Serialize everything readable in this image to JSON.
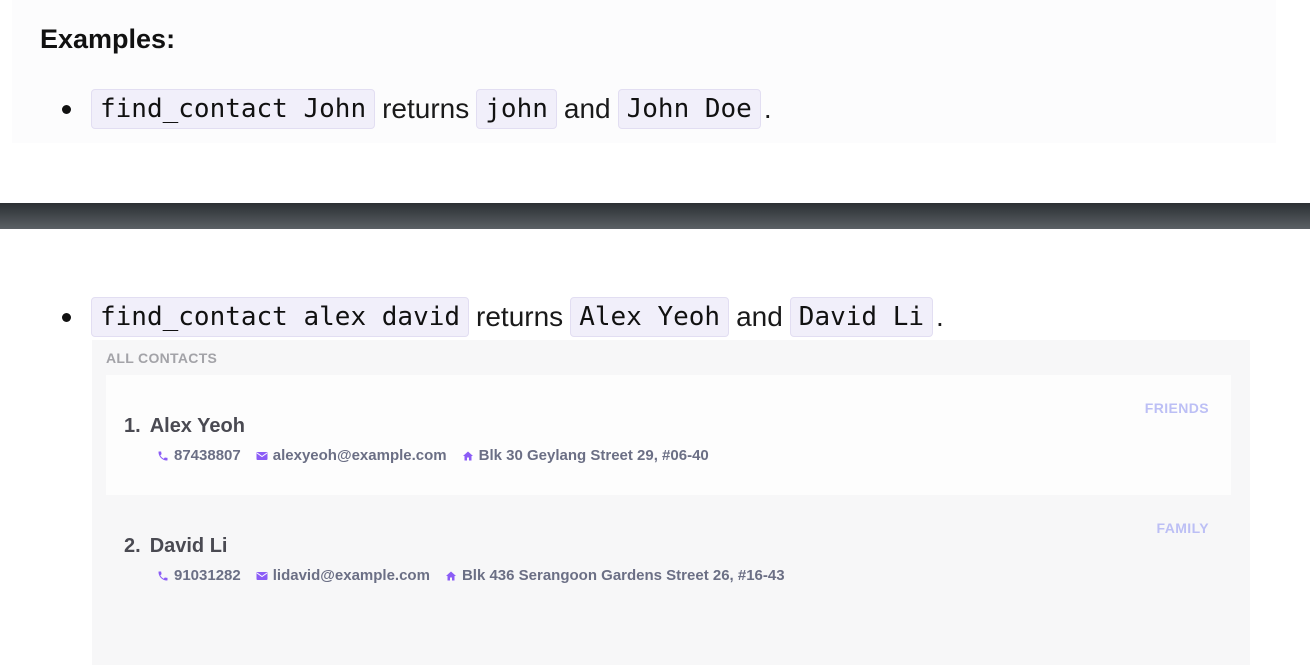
{
  "examples": {
    "heading": "Examples:",
    "example_1": {
      "command": "find_contact John",
      "returns_word": "returns",
      "result_1": "john",
      "and_word": "and",
      "result_2": "John Doe",
      "period": "."
    },
    "example_2": {
      "command": "find_contact alex david",
      "returns_word": "returns",
      "result_1": "Alex Yeoh",
      "and_word": "and",
      "result_2": "David Li",
      "period": "."
    }
  },
  "contact_list": {
    "header": "ALL CONTACTS",
    "contacts": [
      {
        "index": "1.",
        "name": "Alex Yeoh",
        "tag": "FRIENDS",
        "phone": "87438807",
        "email": "alexyeoh@example.com",
        "address": "Blk 30 Geylang Street 29, #06-40"
      },
      {
        "index": "2.",
        "name": "David Li",
        "tag": "FAMILY",
        "phone": "91031282",
        "email": "lidavid@example.com",
        "address": "Blk 436 Serangoon Gardens Street 26, #16-43"
      }
    ]
  },
  "colors": {
    "code_background": "#f1effa",
    "divider_bar": "#3e4347",
    "icon_accent": "#8b5cf6",
    "tag_text": "#bcbff5",
    "detail_text": "#6b6f85"
  },
  "icons": {
    "phone": "phone-icon",
    "email": "email-icon",
    "address": "home-icon"
  }
}
